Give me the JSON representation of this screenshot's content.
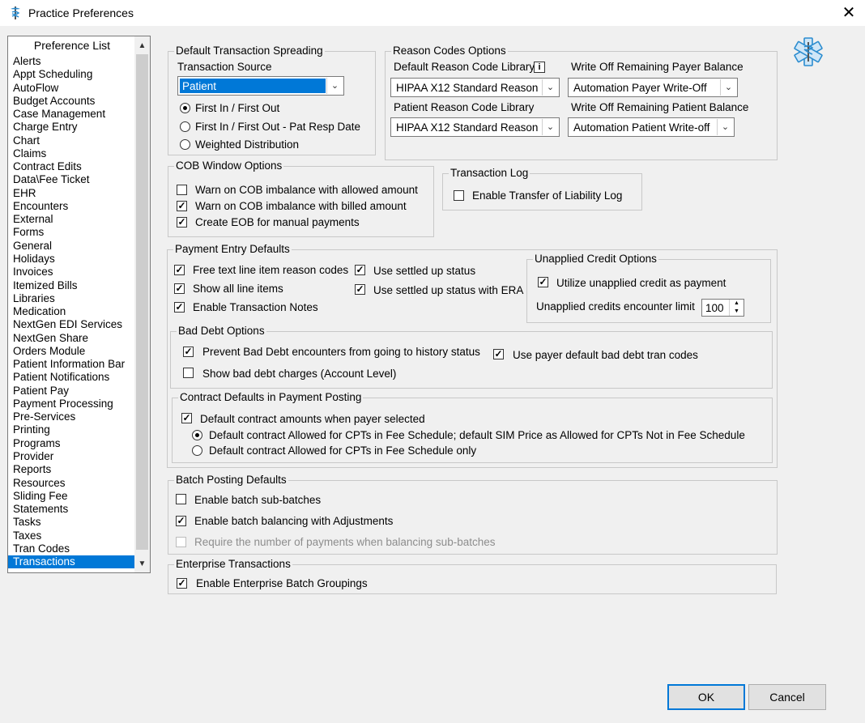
{
  "window": {
    "title": "Practice Preferences"
  },
  "preference_list": {
    "header": "Preference List",
    "items": [
      "Alerts",
      "Appt Scheduling",
      "AutoFlow",
      "Budget Accounts",
      "Case Management",
      "Charge Entry",
      "Chart",
      "Claims",
      "Contract Edits",
      "Data\\Fee Ticket",
      "EHR",
      "Encounters",
      "External",
      "Forms",
      "General",
      "Holidays",
      "Invoices",
      "Itemized Bills",
      "Libraries",
      "Medication",
      "NextGen EDI Services",
      "NextGen Share",
      "Orders Module",
      "Patient Information Bar",
      "Patient Notifications",
      "Patient Pay",
      "Payment Processing",
      "Pre-Services",
      "Printing",
      "Programs",
      "Provider",
      "Reports",
      "Resources",
      "Sliding Fee",
      "Statements",
      "Tasks",
      "Taxes",
      "Tran Codes",
      "Transactions"
    ],
    "selected": "Transactions"
  },
  "spreading": {
    "legend": "Default Transaction Spreading",
    "source_label": "Transaction Source",
    "source_value": "Patient",
    "opt1": "First In / First Out",
    "opt2": "First In / First Out - Pat Resp Date",
    "opt3": "Weighted Distribution",
    "selected": "First In / First Out"
  },
  "reason_codes": {
    "legend": "Reason Codes Options",
    "default_lib_label": "Default Reason Code Library",
    "default_lib_value": "HIPAA X12 Standard Reason",
    "writeoff_payer_label": "Write Off Remaining Payer Balance",
    "writeoff_payer_value": "Automation Payer Write-Off",
    "patient_lib_label": "Patient Reason Code Library",
    "patient_lib_value": "HIPAA X12 Standard Reason",
    "writeoff_patient_label": "Write Off Remaining Patient Balance",
    "writeoff_patient_value": "Automation Patient Write-off",
    "info_glyph": "i"
  },
  "cob": {
    "legend": "COB Window Options",
    "opt1": "Warn on COB imbalance with allowed amount",
    "opt2": "Warn on COB imbalance with billed amount",
    "opt3": "Create EOB for manual payments",
    "checked": [
      false,
      true,
      true
    ]
  },
  "transaction_log": {
    "legend": "Transaction Log",
    "opt1": "Enable Transfer of Liability Log",
    "checked": false
  },
  "payment_entry": {
    "legend": "Payment Entry Defaults",
    "free_text": "Free text line item reason codes",
    "show_all": "Show all line items",
    "enable_notes": "Enable Transaction Notes",
    "settled_up": "Use settled up status",
    "settled_up_era": "Use settled up status with ERA",
    "checked": [
      true,
      true,
      true,
      true,
      true
    ]
  },
  "unapplied": {
    "legend": "Unapplied Credit Options",
    "utilize": "Utilize unapplied credit as payment",
    "utilize_checked": true,
    "limit_label": "Unapplied credits encounter limit",
    "limit_value": "100"
  },
  "bad_debt": {
    "legend": "Bad Debt Options",
    "prevent": "Prevent Bad Debt encounters from going to history status",
    "show_charges": "Show bad debt charges (Account Level)",
    "payer_default": "Use payer default bad debt tran codes",
    "checked": [
      true,
      false,
      true
    ]
  },
  "contract": {
    "legend": "Contract Defaults in Payment Posting",
    "default_amounts": "Default contract amounts when payer selected",
    "default_amounts_checked": true,
    "radio1": "Default contract Allowed for CPTs in Fee Schedule; default SIM Price as Allowed for CPTs Not in Fee Schedule",
    "radio2": "Default contract Allowed for CPTs in Fee Schedule only",
    "selected": 1
  },
  "batch": {
    "legend": "Batch Posting Defaults",
    "sub_batches": "Enable batch sub-batches",
    "balancing": "Enable batch balancing with Adjustments",
    "require_number": "Require the number of payments when balancing sub-batches",
    "checked": [
      false,
      true,
      false
    ]
  },
  "enterprise": {
    "legend": "Enterprise Transactions",
    "groupings": "Enable Enterprise Batch Groupings",
    "checked": true
  },
  "buttons": {
    "ok": "OK",
    "cancel": "Cancel"
  },
  "icons": {
    "app": "caduceus-icon",
    "emblem": "star-of-life-icon",
    "close": "close-icon",
    "dropdown": "chevron-down-icon",
    "info": "info-icon"
  },
  "colors": {
    "selection": "#0078d7",
    "emblem": "#2b8ccf",
    "background": "#f0f0f0"
  }
}
